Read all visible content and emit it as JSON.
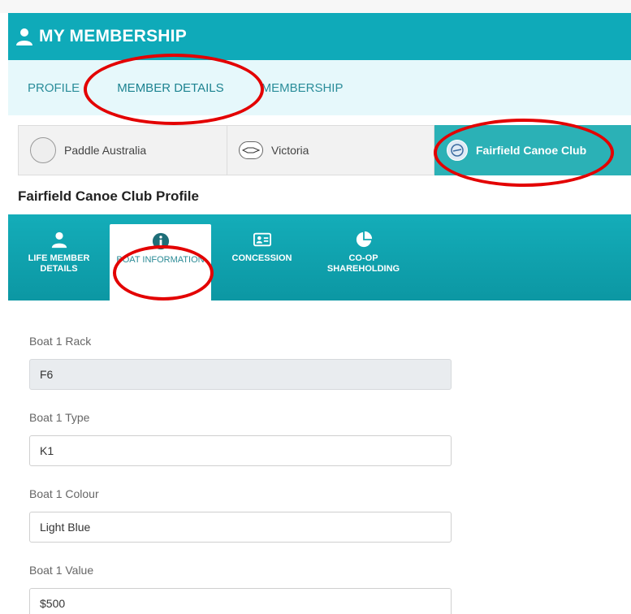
{
  "header": {
    "title": "MY MEMBERSHIP",
    "icon": "user-icon"
  },
  "tabs": [
    {
      "label": "PROFILE",
      "active": false
    },
    {
      "label": "MEMBER DETAILS",
      "active": true
    },
    {
      "label": "MEMBERSHIP",
      "active": false
    }
  ],
  "organisations": [
    {
      "label": "Paddle Australia",
      "active": false
    },
    {
      "label": "Victoria",
      "active": false
    },
    {
      "label": "Fairfield Canoe Club",
      "active": true
    }
  ],
  "profile_heading": "Fairfield Canoe Club Profile",
  "sub_tabs": [
    {
      "label": "LIFE MEMBER DETAILS",
      "icon": "user-icon",
      "active": false
    },
    {
      "label": "BOAT INFORMATION",
      "icon": "info-icon",
      "active": true
    },
    {
      "label": "CONCESSION",
      "icon": "id-card-icon",
      "active": false
    },
    {
      "label": "CO-OP SHAREHOLDING",
      "icon": "pie-chart-icon",
      "active": false
    }
  ],
  "form": {
    "boat1_rack": {
      "label": "Boat 1 Rack",
      "value": "F6"
    },
    "boat1_type": {
      "label": "Boat 1 Type",
      "value": "K1"
    },
    "boat1_colour": {
      "label": "Boat 1 Colour",
      "value": "Light Blue"
    },
    "boat1_value": {
      "label": "Boat 1 Value",
      "value": "$500"
    }
  },
  "colors": {
    "accent": "#0faab9",
    "highlight": "#e30000",
    "tab_bg": "#e6f8fb"
  }
}
